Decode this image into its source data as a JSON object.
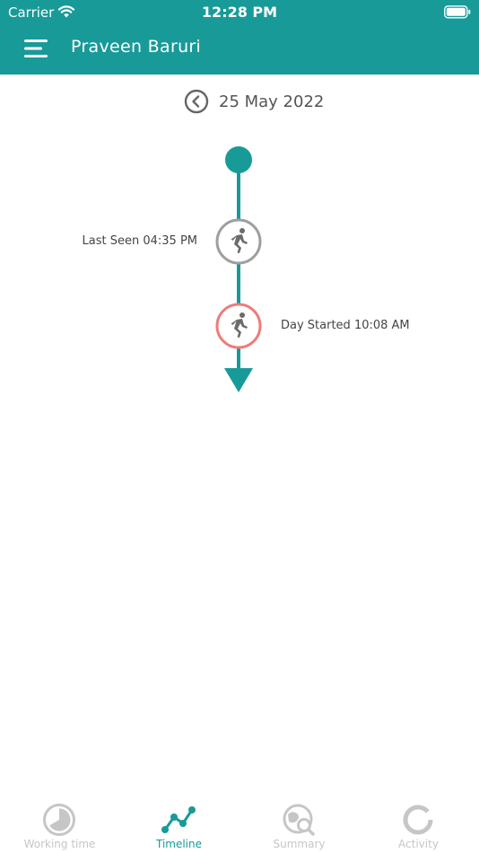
{
  "status_bar": {
    "carrier": "Carrier",
    "time": "12:28 PM"
  },
  "header": {
    "title": "Praveen Baruri",
    "menu_icon": "hamburger-menu-icon"
  },
  "date_nav": {
    "date": "25 May 2022",
    "back_icon": "chevron-left-circle-icon"
  },
  "timeline": {
    "events": [
      {
        "label": "Last Seen 04:35 PM",
        "icon": "running-person-icon",
        "ring_color": "#9e9e9e"
      },
      {
        "label": "Day Started 10:08 AM",
        "icon": "running-person-icon",
        "ring_color": "#ef7b7b"
      }
    ],
    "line_color": "#189a98"
  },
  "tabs": [
    {
      "label": "Working time",
      "icon": "pie-clock-icon",
      "active": false
    },
    {
      "label": "Timeline",
      "icon": "line-graph-icon",
      "active": true
    },
    {
      "label": "Summary",
      "icon": "globe-search-icon",
      "active": false
    },
    {
      "label": "Activity",
      "icon": "ring-progress-icon",
      "active": false
    }
  ],
  "colors": {
    "primary": "#189a98",
    "inactive": "#c6c6c6"
  }
}
